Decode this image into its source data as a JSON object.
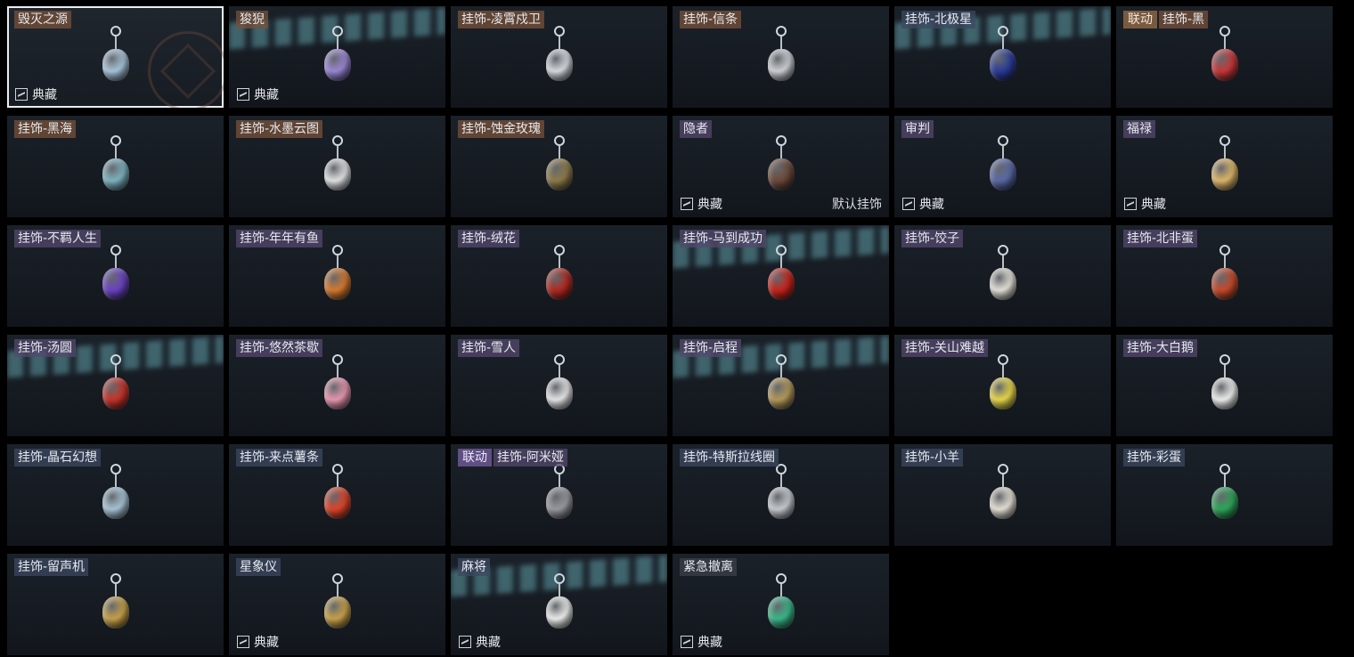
{
  "collection_label": "典藏",
  "default_label": "默认挂饰",
  "collab_label": "联动",
  "items": [
    {
      "name": "毁灭之源",
      "tag": "orange",
      "selected": true,
      "collection": true,
      "color": "#a8c6dc",
      "icon": "mecha-dragon-icon"
    },
    {
      "name": "狻猊",
      "tag": "orange",
      "collection": true,
      "glare": true,
      "color": "#9b87d6",
      "icon": "lion-beast-icon"
    },
    {
      "name": "挂饰-凌霄戍卫",
      "tag": "orange",
      "color": "#d8dce2",
      "icon": "rocket-icon"
    },
    {
      "name": "挂饰-信条",
      "tag": "orange",
      "color": "#cfd3d8",
      "icon": "teapot-icon"
    },
    {
      "name": "挂饰-北极星",
      "tag": "blue",
      "glare": true,
      "color": "#2a3c9a",
      "icon": "feather-icon"
    },
    {
      "name": "挂饰-黑",
      "tag": "orange",
      "collab": true,
      "color": "#c9383a",
      "icon": "bottle-icon"
    },
    {
      "name": "挂饰-黑海",
      "tag": "orange",
      "color": "#7fb5c2",
      "icon": "anchor-icon"
    },
    {
      "name": "挂饰-水墨云图",
      "tag": "orange",
      "color": "#e2e4e6",
      "icon": "patterned-ball-icon"
    },
    {
      "name": "挂饰-蚀金玫瑰",
      "tag": "orange",
      "color": "#8e7b4a",
      "icon": "gold-rose-icon"
    },
    {
      "name": "隐者",
      "tag": "purple",
      "collection": true,
      "default": true,
      "color": "#6d4a3a",
      "icon": "tarot-card-icon"
    },
    {
      "name": "审判",
      "tag": "purple",
      "collection": true,
      "color": "#5a6aa8",
      "icon": "tarot-card-icon"
    },
    {
      "name": "福禄",
      "tag": "purple",
      "collection": true,
      "color": "#e0b86a",
      "icon": "gourd-icon"
    },
    {
      "name": "挂饰-不羁人生",
      "tag": "purple",
      "color": "#6b43c4",
      "icon": "sneaker-icon"
    },
    {
      "name": "挂饰-年年有鱼",
      "tag": "purple",
      "color": "#d87a2e",
      "icon": "fish-plate-icon"
    },
    {
      "name": "挂饰-绒花",
      "tag": "purple",
      "color": "#b22a22",
      "icon": "flower-icon"
    },
    {
      "name": "挂饰-马到成功",
      "tag": "purple",
      "glare": true,
      "color": "#c8241c",
      "icon": "horse-icon"
    },
    {
      "name": "挂饰-饺子",
      "tag": "purple",
      "color": "#e6e2da",
      "icon": "dumpling-plate-icon"
    },
    {
      "name": "挂饰-北非蛋",
      "tag": "purple",
      "color": "#c84a2a",
      "icon": "egg-pan-icon"
    },
    {
      "name": "挂饰-汤圆",
      "tag": "purple",
      "glare": true,
      "color": "#c8342a",
      "icon": "tangyuan-bowl-icon"
    },
    {
      "name": "挂饰-悠然茶歇",
      "tag": "purple",
      "color": "#e898b0",
      "icon": "cupcake-icon"
    },
    {
      "name": "挂饰-雪人",
      "tag": "purple",
      "color": "#e8e8ea",
      "icon": "snowman-icon"
    },
    {
      "name": "挂饰-启程",
      "tag": "purple",
      "glare": true,
      "color": "#b49a5a",
      "icon": "compass-icon"
    },
    {
      "name": "挂饰-关山难越",
      "tag": "purple",
      "color": "#e8d84a",
      "icon": "scroll-icon"
    },
    {
      "name": "挂饰-大白鹅",
      "tag": "purple",
      "color": "#f0f0f0",
      "icon": "goose-icon"
    },
    {
      "name": "挂饰-晶石幻想",
      "tag": "blue",
      "color": "#a9c6d8",
      "icon": "crystal-cube-icon"
    },
    {
      "name": "挂饰-来点薯条",
      "tag": "blue",
      "color": "#e0442a",
      "icon": "fries-icon"
    },
    {
      "name": "挂饰-阿米娅",
      "tag": "purple",
      "collab": true,
      "collab_purple": true,
      "color": "#9a9aa2",
      "icon": "bunny-icon"
    },
    {
      "name": "挂饰-特斯拉线圈",
      "tag": "blue",
      "color": "#c8ccd2",
      "icon": "tesla-coil-icon"
    },
    {
      "name": "挂饰-小羊",
      "tag": "blue",
      "color": "#e8e2d6",
      "icon": "sheep-icon"
    },
    {
      "name": "挂饰-彩蛋",
      "tag": "blue",
      "color": "#2ea85a",
      "icon": "easter-egg-icon"
    },
    {
      "name": "挂饰-留声机",
      "tag": "blue",
      "color": "#c8a24a",
      "icon": "gramophone-icon"
    },
    {
      "name": "星象仪",
      "tag": "blue",
      "collection": true,
      "color": "#c9a24a",
      "icon": "astrolabe-icon"
    },
    {
      "name": "麻将",
      "tag": "blue",
      "collection": true,
      "glare": true,
      "color": "#eef0ee",
      "icon": "mahjong-tile-icon"
    },
    {
      "name": "紧急撤离",
      "tag": "gray",
      "collection": true,
      "color": "#3ab88a",
      "icon": "exit-sign-icon"
    }
  ]
}
